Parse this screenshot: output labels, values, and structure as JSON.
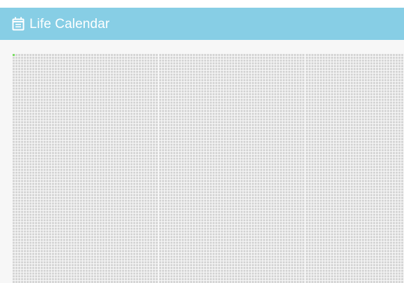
{
  "app": {
    "title": "Life Calendar",
    "icon": "calendar-icon"
  },
  "calendar": {
    "weeks_per_row": 52,
    "weeks_lived": 1,
    "colors": {
      "header_bg": "#87cee5",
      "cell_default": "#d6d6d6",
      "cell_lived": "#7bdc64",
      "page_bg": "#f7f7f7"
    }
  }
}
